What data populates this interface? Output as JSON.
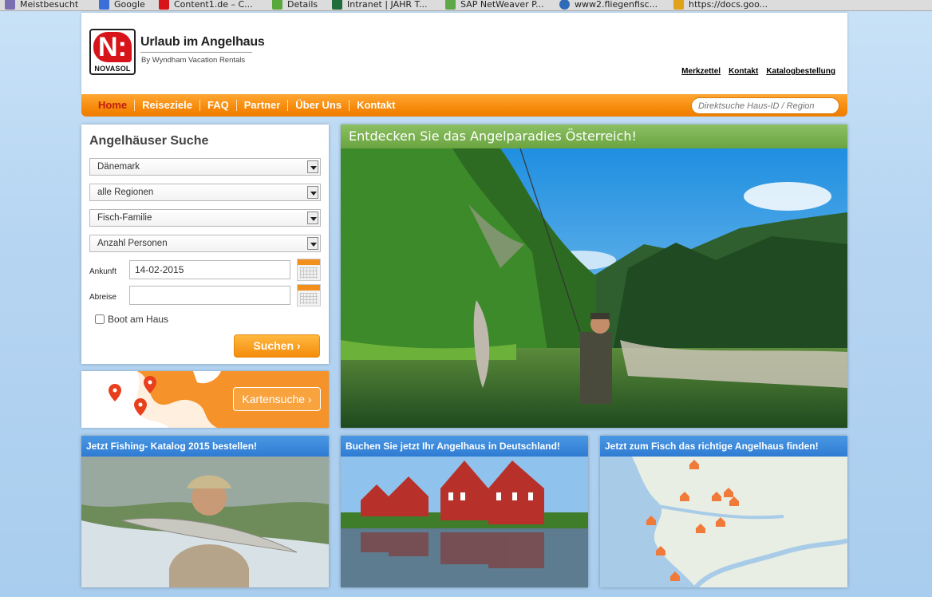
{
  "bookmarks": [
    {
      "label": "Meistbesucht",
      "color": "#7a6fb0"
    },
    {
      "label": "Google",
      "color": "#3b6fd8"
    },
    {
      "label": "Content1.de – C...",
      "color": "#d8141b"
    },
    {
      "label": "Details",
      "color": "#58a83c"
    },
    {
      "label": "Intranet | JAHR T...",
      "color": "#1f6d3a"
    },
    {
      "label": "SAP NetWeaver P...",
      "color": "#5fa84a"
    },
    {
      "label": "www2.fliegenfisc...",
      "color": "#2f6cb8"
    },
    {
      "label": "https://docs.goo...",
      "color": "#e0a21a"
    }
  ],
  "header": {
    "logo_letter": "N:",
    "logo_text": "NOVASOL",
    "brand_title": "Urlaub im Angelhaus",
    "brand_sub": "By Wyndham Vacation Rentals",
    "links": [
      "Merkzettel",
      "Kontakt",
      "Katalogbestellung"
    ]
  },
  "nav": {
    "items": [
      "Home",
      "Reiseziele",
      "FAQ",
      "Partner",
      "Über Uns",
      "Kontakt"
    ],
    "active_index": 0,
    "search_placeholder": "Direktsuche Haus-ID / Region"
  },
  "search": {
    "title": "Angelhäuser Suche",
    "selects": [
      "Dänemark",
      "alle Regionen",
      "Fisch-Familie",
      "Anzahl Personen"
    ],
    "arrival_label": "Ankunft",
    "arrival_value": "14-02-2015",
    "departure_label": "Abreise",
    "departure_value": "",
    "boat_label": "Boot am Haus",
    "submit_label": "Suchen ›"
  },
  "karten": {
    "button_label": "Kartensuche ›"
  },
  "hero": {
    "title": "Entdecken Sie das Angelparadies Österreich!"
  },
  "teasers": [
    {
      "title": "Jetzt Fishing- Katalog 2015 bestellen!"
    },
    {
      "title": "Buchen Sie jetzt Ihr Angelhaus in Deutschland!"
    },
    {
      "title": "Jetzt zum Fisch das richtige Angelhaus finden!"
    }
  ],
  "colors": {
    "orange": "#f68a0a",
    "nav_active": "#c0200e",
    "green_bar": "#7ab14f",
    "blue_bar": "#3a8adb",
    "logo_red": "#d8141b"
  }
}
